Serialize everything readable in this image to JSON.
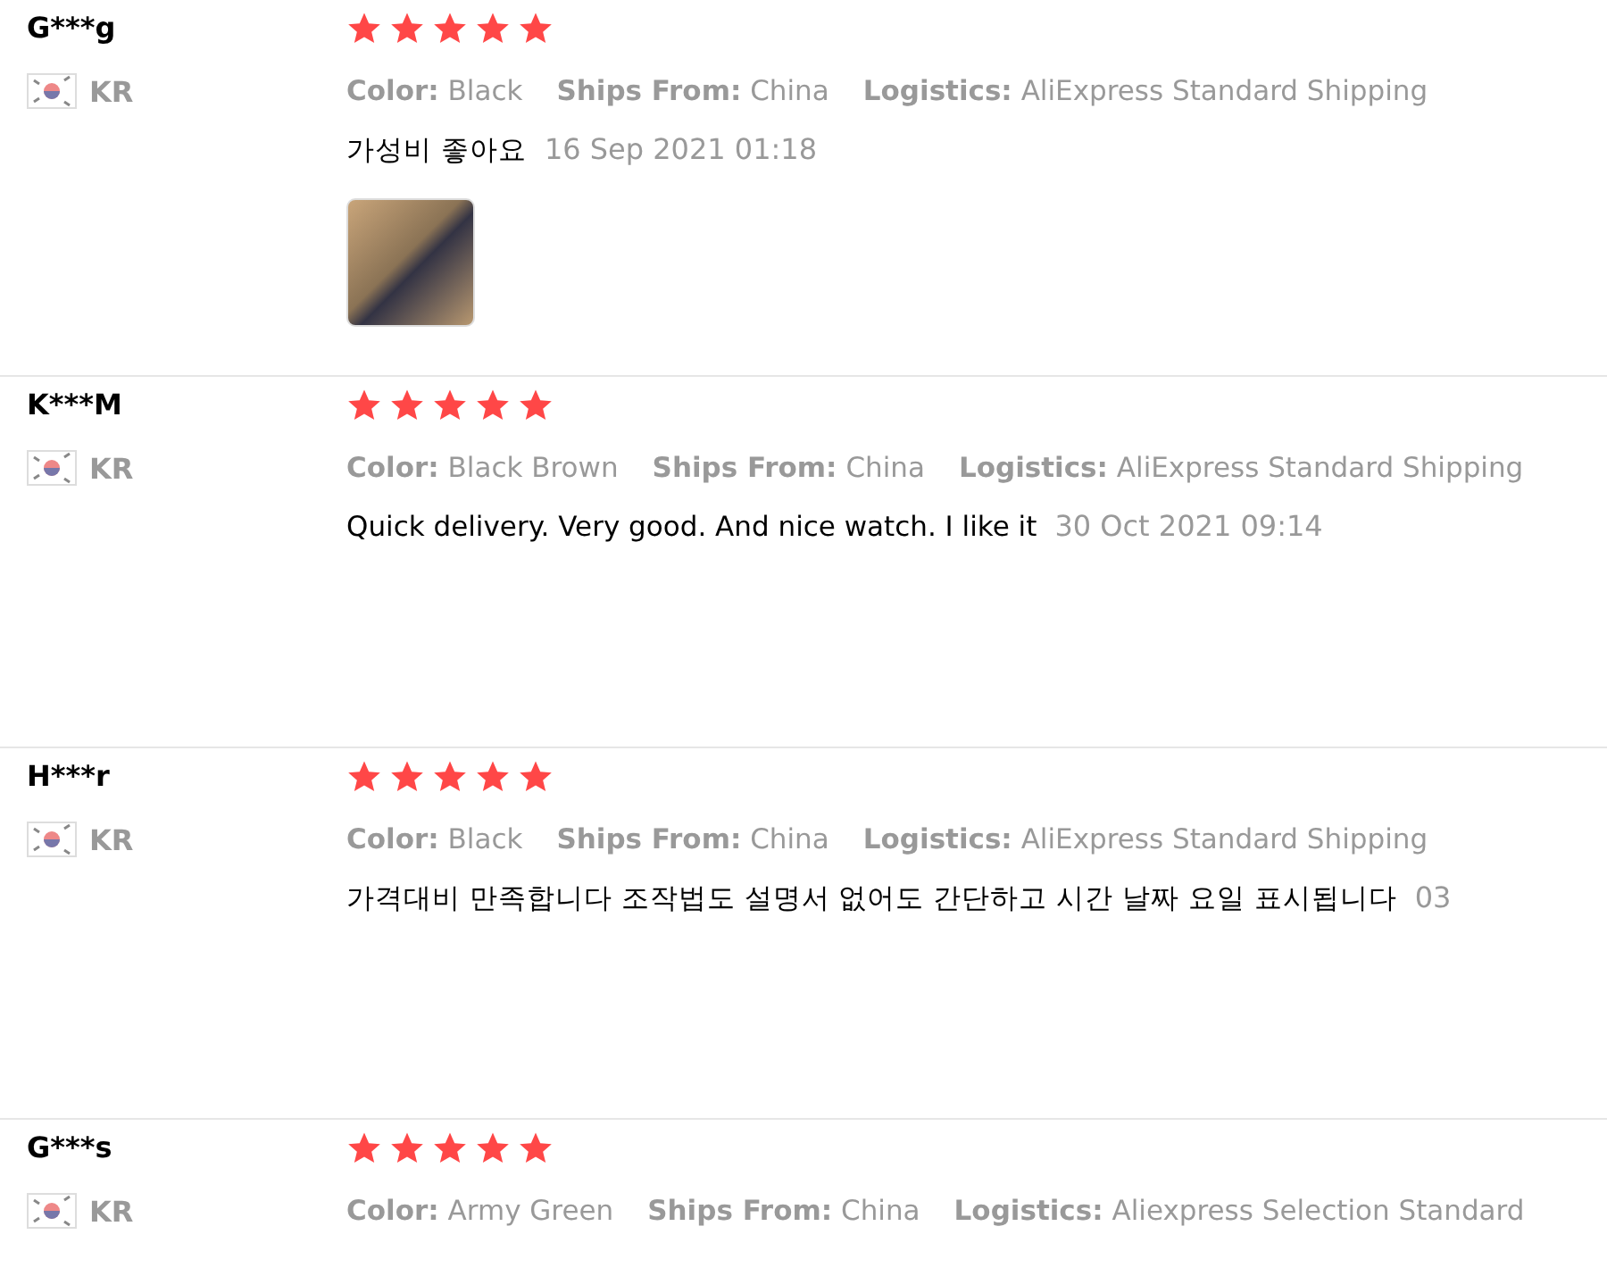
{
  "reviews": [
    {
      "name": "G***g",
      "country": "KR",
      "stars": 5,
      "attributes": [
        {
          "label": "Color:",
          "value": "Black"
        },
        {
          "label": "Ships From:",
          "value": "China"
        },
        {
          "label": "Logistics:",
          "value": "AliExpress Standard Shipping"
        }
      ],
      "text": "가성비 좋아요",
      "date": "16 Sep 2021 01:18",
      "photo": true
    },
    {
      "name": "K***M",
      "country": "KR",
      "stars": 5,
      "attributes": [
        {
          "label": "Color:",
          "value": "Black Brown"
        },
        {
          "label": "Ships From:",
          "value": "China"
        },
        {
          "label": "Logistics:",
          "value": "AliExpress Standard Shipping"
        }
      ],
      "text": "Quick delivery. Very good. And nice watch. I like it",
      "date": "30 Oct 2021 09:14"
    },
    {
      "name": "H***r",
      "country": "KR",
      "stars": 5,
      "attributes": [
        {
          "label": "Color:",
          "value": "Black"
        },
        {
          "label": "Ships From:",
          "value": "China"
        },
        {
          "label": "Logistics:",
          "value": "AliExpress Standard Shipping"
        }
      ],
      "text": "가격대비 만족합니다 조작법도 설명서 없어도 간단하고 시간 날짜 요일 표시됩니다",
      "date": "03"
    },
    {
      "name": "G***s",
      "country": "KR",
      "stars": 5,
      "attributes": [
        {
          "label": "Color:",
          "value": "Army Green"
        },
        {
          "label": "Ships From:",
          "value": "China"
        },
        {
          "label": "Logistics:",
          "value": "Aliexpress Selection Standard"
        }
      ]
    }
  ]
}
